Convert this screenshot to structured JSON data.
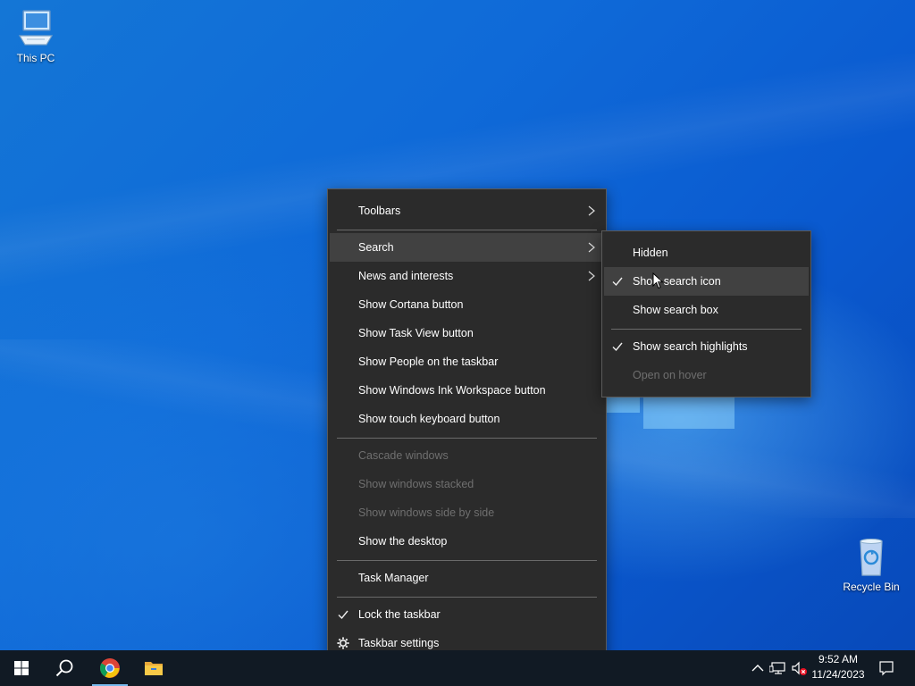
{
  "desktop": {
    "icons": [
      {
        "label": "This PC"
      },
      {
        "label": "Recycle Bin"
      }
    ]
  },
  "context_menu": {
    "items": [
      {
        "label": "Toolbars",
        "submenu": true
      },
      {
        "label": "Search",
        "submenu": true,
        "highlighted": true
      },
      {
        "label": "News and interests",
        "submenu": true
      },
      {
        "label": "Show Cortana button"
      },
      {
        "label": "Show Task View button"
      },
      {
        "label": "Show People on the taskbar"
      },
      {
        "label": "Show Windows Ink Workspace button"
      },
      {
        "label": "Show touch keyboard button"
      },
      {
        "label": "Cascade windows",
        "disabled": true
      },
      {
        "label": "Show windows stacked",
        "disabled": true
      },
      {
        "label": "Show windows side by side",
        "disabled": true
      },
      {
        "label": "Show the desktop"
      },
      {
        "label": "Task Manager"
      },
      {
        "label": "Lock the taskbar",
        "checked": true
      },
      {
        "label": "Taskbar settings",
        "icon": "gear-icon"
      }
    ]
  },
  "search_submenu": {
    "items": [
      {
        "label": "Hidden"
      },
      {
        "label": "Show search icon",
        "checked": true,
        "highlighted": true
      },
      {
        "label": "Show search box"
      },
      {
        "label": "Show search highlights",
        "checked": true
      },
      {
        "label": "Open on hover",
        "disabled": true
      }
    ]
  },
  "taskbar": {
    "buttons": [
      {
        "name": "start",
        "icon": "windows-logo-icon"
      },
      {
        "name": "search",
        "icon": "search-icon"
      },
      {
        "name": "chrome",
        "icon": "chrome-icon",
        "active": true
      },
      {
        "name": "file-explorer",
        "icon": "folder-icon"
      }
    ],
    "tray_icons": [
      "chevron-up-icon",
      "network-icon",
      "volume-muted-icon",
      "notification-icon"
    ],
    "clock": {
      "time": "9:52 AM",
      "date": "11/24/2023"
    }
  },
  "colors": {
    "menu_bg": "#2b2b2b",
    "menu_highlight": "#414141",
    "taskbar_bg": "#111a24",
    "accent": "#76b9ed"
  }
}
